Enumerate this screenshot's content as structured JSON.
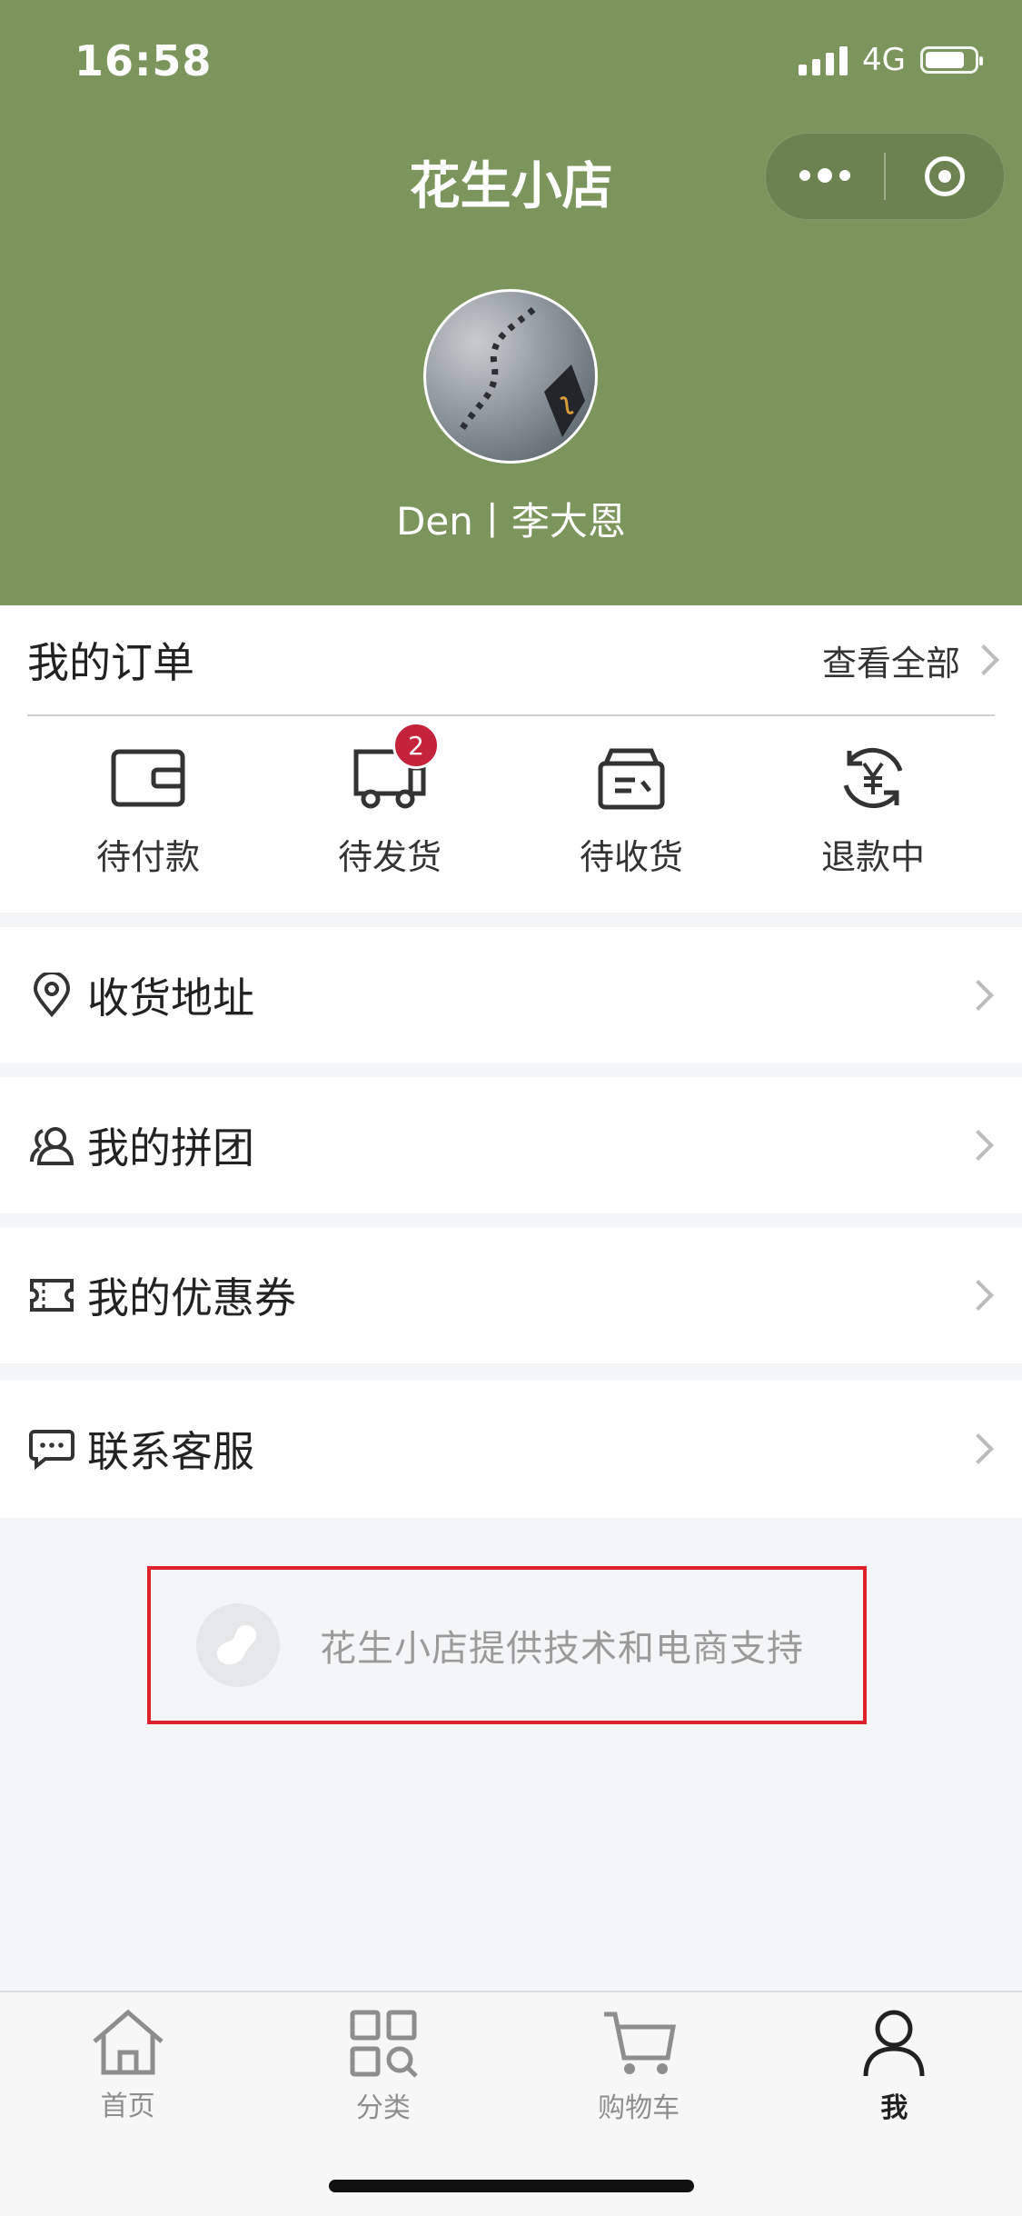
{
  "status_bar": {
    "time": "16:58",
    "network": "4G"
  },
  "header": {
    "title": "花生小店",
    "user_name": "Den丨李大恩"
  },
  "orders": {
    "title": "我的订单",
    "view_all": "查看全部",
    "items": [
      {
        "label": "待付款",
        "icon": "wallet-icon"
      },
      {
        "label": "待发货",
        "icon": "truck-icon",
        "badge": "2"
      },
      {
        "label": "待收货",
        "icon": "package-icon"
      },
      {
        "label": "退款中",
        "icon": "refund-icon"
      }
    ]
  },
  "menu": [
    {
      "label": "收货地址",
      "icon": "location-pin-icon"
    },
    {
      "label": "我的拼团",
      "icon": "group-icon"
    },
    {
      "label": "我的优惠券",
      "icon": "coupon-icon"
    },
    {
      "label": "联系客服",
      "icon": "chat-icon"
    }
  ],
  "support_text": "花生小店提供技术和电商支持",
  "tabbar": {
    "items": [
      {
        "label": "首页",
        "icon": "home-icon"
      },
      {
        "label": "分类",
        "icon": "category-icon"
      },
      {
        "label": "购物车",
        "icon": "cart-icon"
      },
      {
        "label": "我",
        "icon": "user-icon",
        "active": true
      }
    ]
  },
  "colors": {
    "header_bg": "#7c955c",
    "badge": "#c5233c",
    "highlight_border": "#e0212c"
  }
}
